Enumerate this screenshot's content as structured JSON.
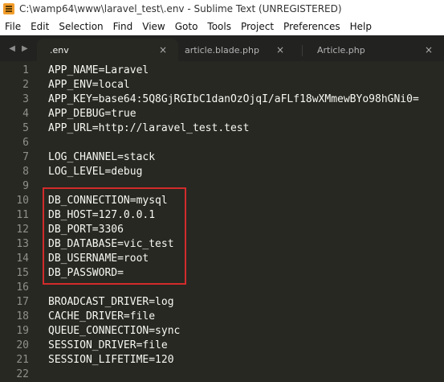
{
  "window": {
    "title": "C:\\wamp64\\www\\laravel_test\\.env - Sublime Text (UNREGISTERED)"
  },
  "menu": [
    "File",
    "Edit",
    "Selection",
    "Find",
    "View",
    "Goto",
    "Tools",
    "Project",
    "Preferences",
    "Help"
  ],
  "tabs": [
    {
      "label": ".env",
      "close": "×",
      "active": true
    },
    {
      "label": "article.blade.php",
      "close": "×",
      "active": false
    },
    {
      "label": "Article.php",
      "close": "×",
      "active": false
    }
  ],
  "nav": {
    "back": "◀",
    "forward": "▶"
  },
  "lines": [
    {
      "n": "1",
      "text": "APP_NAME=Laravel"
    },
    {
      "n": "2",
      "text": "APP_ENV=local"
    },
    {
      "n": "3",
      "text": "APP_KEY=base64:5Q8GjRGIbC1danOzOjqI/aFLf18wXMmewBYo98hGNi0="
    },
    {
      "n": "4",
      "text": "APP_DEBUG=true"
    },
    {
      "n": "5",
      "text": "APP_URL=http://laravel_test.test"
    },
    {
      "n": "6",
      "text": ""
    },
    {
      "n": "7",
      "text": "LOG_CHANNEL=stack"
    },
    {
      "n": "8",
      "text": "LOG_LEVEL=debug"
    },
    {
      "n": "9",
      "text": ""
    },
    {
      "n": "10",
      "text": "DB_CONNECTION=mysql"
    },
    {
      "n": "11",
      "text": "DB_HOST=127.0.0.1"
    },
    {
      "n": "12",
      "text": "DB_PORT=3306"
    },
    {
      "n": "13",
      "text": "DB_DATABASE=vic_test"
    },
    {
      "n": "14",
      "text": "DB_USERNAME=root"
    },
    {
      "n": "15",
      "text": "DB_PASSWORD="
    },
    {
      "n": "16",
      "text": ""
    },
    {
      "n": "17",
      "text": "BROADCAST_DRIVER=log"
    },
    {
      "n": "18",
      "text": "CACHE_DRIVER=file"
    },
    {
      "n": "19",
      "text": "QUEUE_CONNECTION=sync"
    },
    {
      "n": "20",
      "text": "SESSION_DRIVER=file"
    },
    {
      "n": "21",
      "text": "SESSION_LIFETIME=120"
    },
    {
      "n": "22",
      "text": ""
    }
  ],
  "colors": {
    "editor_bg": "#272822",
    "highlight_border": "#d12b2b"
  }
}
